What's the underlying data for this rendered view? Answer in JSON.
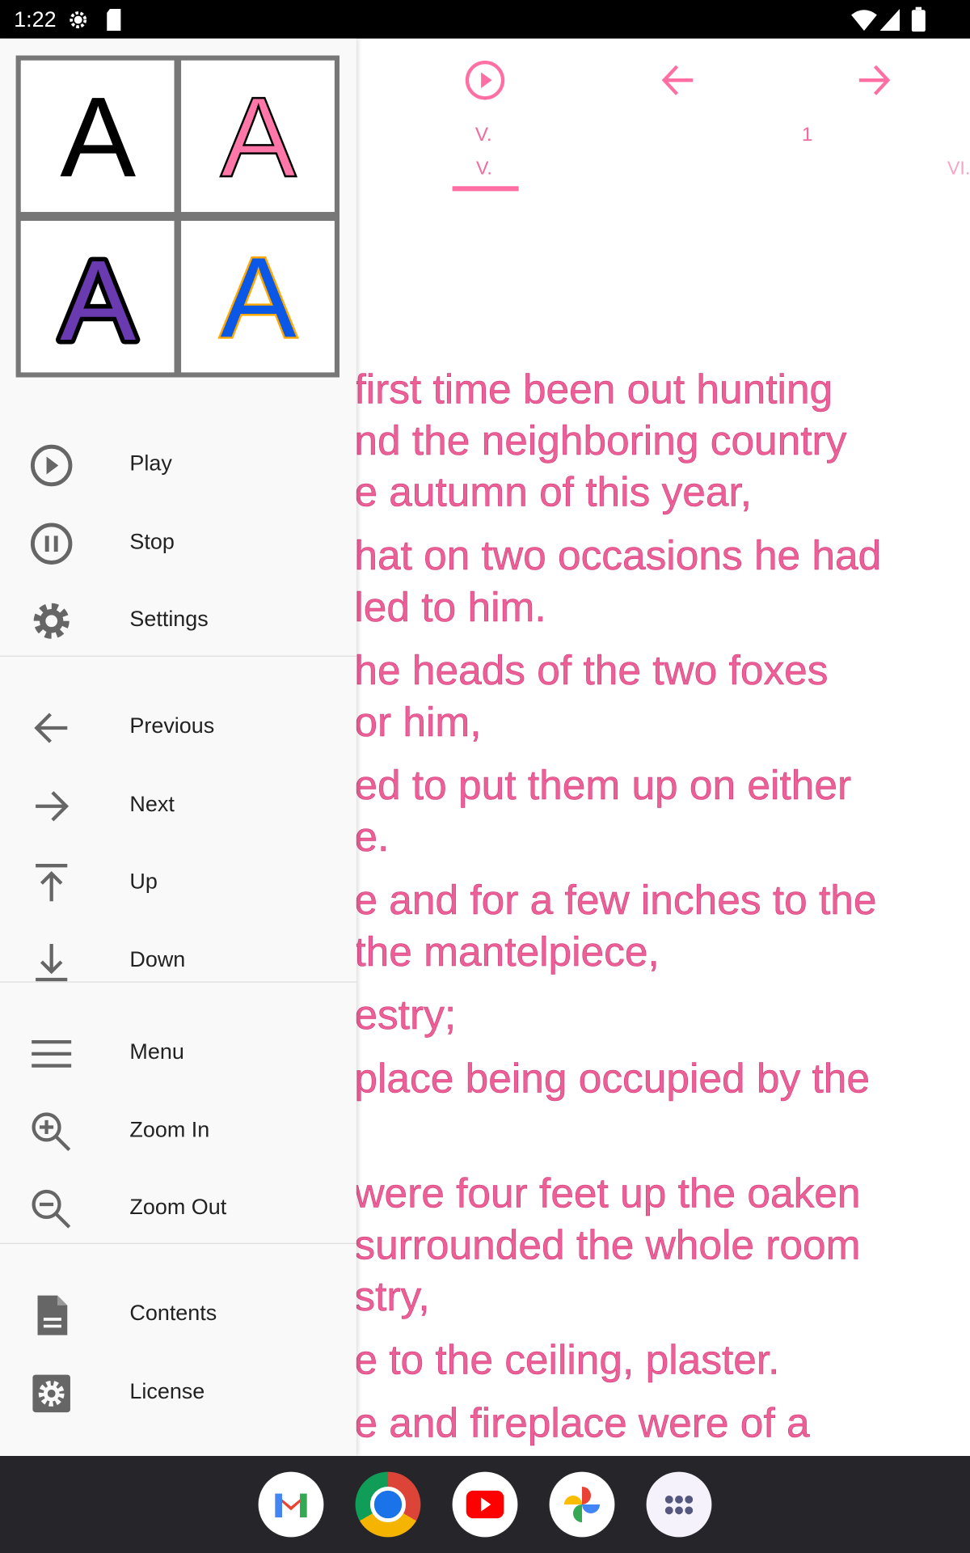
{
  "status_bar": {
    "time": "1:22",
    "icons": [
      "settings-icon",
      "sd-card-icon",
      "wifi-icon",
      "signal-icon",
      "battery-icon"
    ]
  },
  "toolbar": {
    "icons": [
      "play-circle-icon",
      "arrow-left-icon",
      "arrow-right-icon"
    ],
    "color": "#ff6fa3"
  },
  "tabs": {
    "current_top": "V.",
    "page": "1",
    "current": "V.",
    "next": "VI."
  },
  "text": {
    "paragraphs": [
      [
        "first time been out hunting",
        "nd the neighboring country",
        "e autumn of this year,"
      ],
      [
        "hat on two occasions he had",
        "led to him."
      ],
      [
        "he heads of the two foxes",
        "or him,"
      ],
      [
        "ed to put them up on either",
        "e."
      ],
      [
        "e and for a few inches to the",
        " the mantelpiece,"
      ],
      [
        "estry;"
      ],
      [
        " place being occupied by the",
        ""
      ],
      [
        " were four feet up the oaken",
        " surrounded the whole room",
        "stry,"
      ],
      [
        "e to the ceiling, plaster."
      ],
      [
        "e and fireplace were of a"
      ]
    ],
    "color": "#ec5f97"
  },
  "drawer": {
    "font_samples": [
      "A",
      "A",
      "A",
      "A"
    ],
    "groups": [
      [
        {
          "label": "Play",
          "icon": "play-circle-icon"
        },
        {
          "label": "Stop",
          "icon": "pause-circle-icon"
        },
        {
          "label": "Settings",
          "icon": "gear-icon"
        }
      ],
      [
        {
          "label": "Previous",
          "icon": "arrow-left-icon"
        },
        {
          "label": "Next",
          "icon": "arrow-right-icon"
        },
        {
          "label": "Up",
          "icon": "arrow-up-to-top-icon"
        },
        {
          "label": "Down",
          "icon": "arrow-down-to-bottom-icon"
        }
      ],
      [
        {
          "label": "Menu",
          "icon": "menu-icon"
        },
        {
          "label": "Zoom In",
          "icon": "zoom-in-icon"
        },
        {
          "label": "Zoom Out",
          "icon": "zoom-out-icon"
        }
      ],
      [
        {
          "label": "Contents",
          "icon": "document-icon"
        },
        {
          "label": "License",
          "icon": "gear-box-icon"
        }
      ]
    ]
  },
  "dock": {
    "apps": [
      "Gmail",
      "Chrome",
      "YouTube",
      "Photos",
      "App drawer"
    ]
  }
}
